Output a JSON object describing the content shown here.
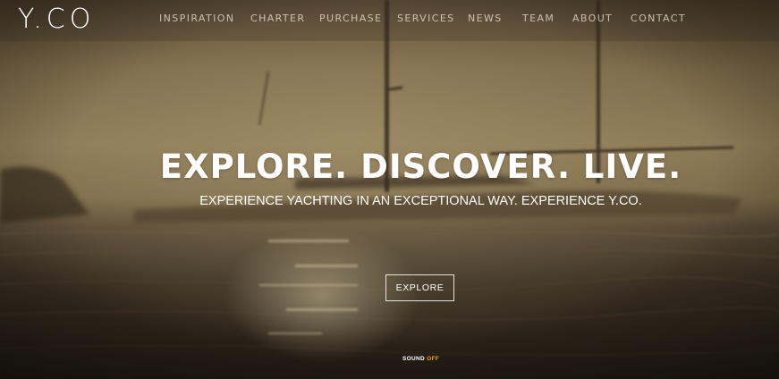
{
  "brand": {
    "logo": "Y.CO"
  },
  "nav": {
    "items": [
      {
        "label": "INSPIRATION"
      },
      {
        "label": "CHARTER"
      },
      {
        "label": "PURCHASE"
      },
      {
        "label": "SERVICES"
      },
      {
        "label": "NEWS"
      },
      {
        "label": "TEAM"
      },
      {
        "label": "ABOUT"
      },
      {
        "label": "CONTACT"
      }
    ]
  },
  "hero": {
    "headline": "EXPLORE. DISCOVER. LIVE.",
    "subheadline": "EXPERIENCE YACHTING IN AN EXCEPTIONAL WAY. EXPERIENCE Y.CO.",
    "cta_label": "EXPLORE",
    "background": "sailing-yacht-at-sunset-photo"
  },
  "sound": {
    "label": "SOUND",
    "state": "OFF",
    "state_color": "#e8a21a"
  }
}
